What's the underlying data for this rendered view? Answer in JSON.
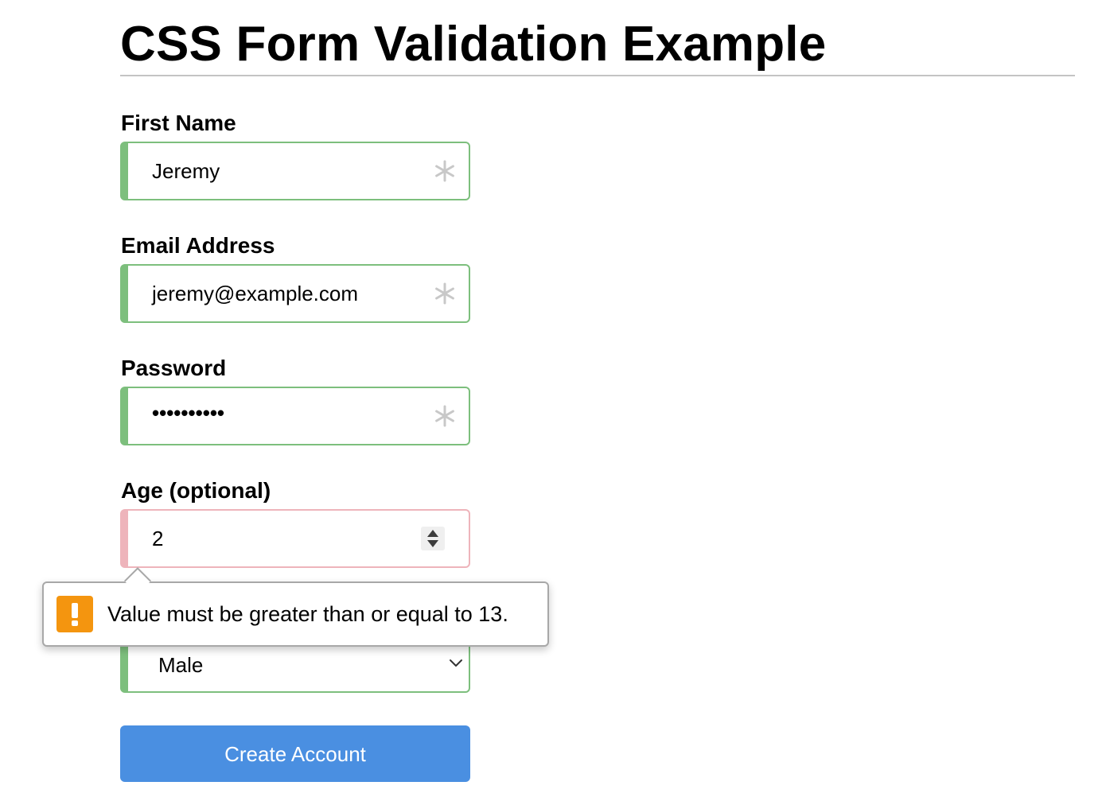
{
  "page": {
    "title": "CSS Form Validation Example"
  },
  "form": {
    "first_name": {
      "label": "First Name",
      "value": "Jeremy",
      "state": "valid",
      "required_icon": "asterisk-icon"
    },
    "email": {
      "label": "Email Address",
      "value": "jeremy@example.com",
      "state": "valid",
      "required_icon": "asterisk-icon"
    },
    "password": {
      "label": "Password",
      "masked_value": "••••••••••",
      "state": "valid",
      "required_icon": "asterisk-icon"
    },
    "age": {
      "label": "Age (optional)",
      "value": "2",
      "state": "invalid",
      "control_icon": "number-spinner-icon"
    },
    "gender": {
      "selected": "Male",
      "state": "valid",
      "control_icon": "chevron-down-icon"
    },
    "submit_label": "Create Account"
  },
  "validation_tooltip": {
    "icon": "warning-icon",
    "message": "Value must be greater than or equal to 13."
  },
  "colors": {
    "valid_border": "#7dbf7d",
    "invalid_border": "#eeb4bb",
    "button_bg": "#4a8fe1",
    "warning_icon_bg": "#f4950f",
    "required_icon": "#c8c8c8"
  }
}
